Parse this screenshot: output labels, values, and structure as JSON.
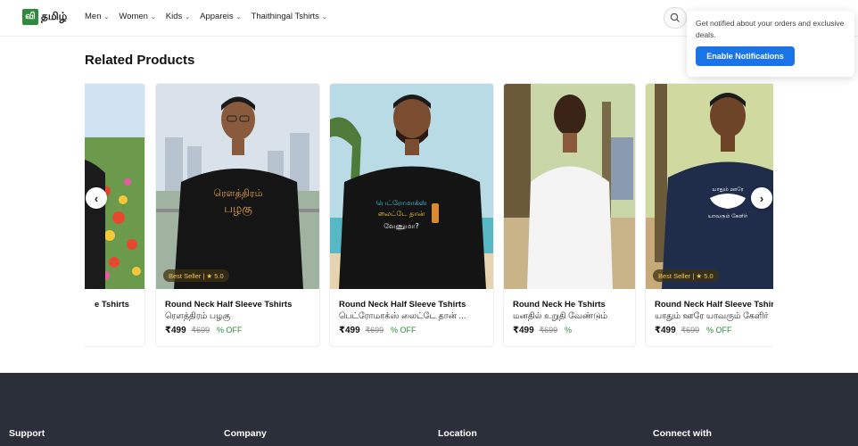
{
  "header": {
    "logo_badge": "வி",
    "logo_text": "தமிழ்",
    "nav": [
      {
        "label": "Men"
      },
      {
        "label": "Women"
      },
      {
        "label": "Kids"
      },
      {
        "label": "Appareis"
      },
      {
        "label": "Thaithingal Tshirts"
      }
    ]
  },
  "popup": {
    "text": "Get notified about your orders and exclusive deals.",
    "button": "Enable Notifications"
  },
  "section_title": "Related Products",
  "products": [
    {
      "title": "Round Neck Half Sleeve Tshirts",
      "visible_title": "e Tshirts",
      "subtitle": "",
      "price": "",
      "mrp": "",
      "off": "",
      "badge": ""
    },
    {
      "title": "Round Neck Half Sleeve Tshirts",
      "subtitle": "ரௌத்திரம் பழகு",
      "price": "₹499",
      "mrp": "₹699",
      "off": "% OFF",
      "badge": "Best Seller | ★ 5.0",
      "shirt_text": "ரௌத்திரம் பழகு"
    },
    {
      "title": "Round Neck Half Sleeve Tshirts",
      "subtitle": "பெட்ரோமாக்ஸ் லைட்டே தான் ...",
      "price": "₹499",
      "mrp": "₹699",
      "off": "% OFF",
      "badge": "",
      "shirt_text": "பெட்ரோமாக்ஸ் லைட்டே தான் வேணுமா?"
    },
    {
      "title": "Round Neck He Tshirts",
      "subtitle": "மனதில் உறுதி வேண்டும்",
      "price": "₹499",
      "mrp": "₹699",
      "off": "%",
      "badge": ""
    },
    {
      "title": "Round Neck Half Sleeve Tshirts",
      "subtitle": "யாதும் ஊரே யாவரும் கேளிர்",
      "price": "₹499",
      "mrp": "₹699",
      "off": "% OFF",
      "badge": "Best Seller | ★ 5.0",
      "shirt_text": "யாதும் ஊரே யாவரும் கேளிர்"
    }
  ],
  "footer": {
    "columns": [
      "Support",
      "Company",
      "Location",
      "Connect with"
    ]
  },
  "colors": {
    "accent": "#1a73e8",
    "logo_green": "#2f8a3b",
    "discount_green": "#2e8b3a",
    "footer_bg": "#2a2f3a"
  },
  "icons": [
    "search-icon",
    "chevron-down-icon",
    "chevron-left-icon",
    "chevron-right-icon",
    "star-icon"
  ]
}
